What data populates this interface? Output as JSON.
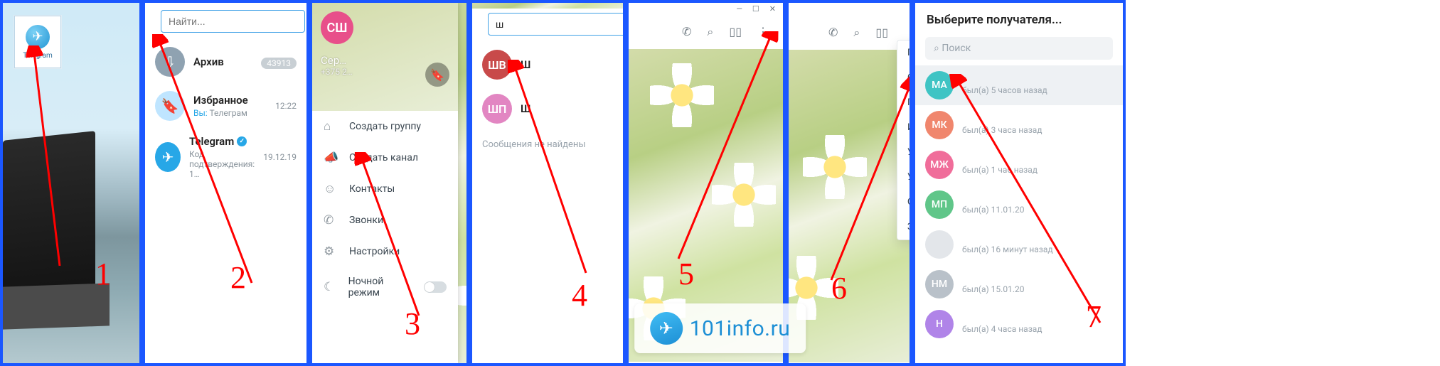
{
  "panel1": {
    "icon_label": "Telegram",
    "step": "1"
  },
  "panel2": {
    "search_placeholder": "Найти...",
    "archive": {
      "label": "Архив",
      "badge": "43913"
    },
    "saved": {
      "title": "Избранное",
      "sub_prefix": "Вы:",
      "sub_text": "Телеграм",
      "time": "12:22"
    },
    "telegram": {
      "title": "Telegram",
      "sub": "Код подтверждения: 1…",
      "time": "19.12.19"
    },
    "step": "2"
  },
  "panel3": {
    "avatar_initials": "СШ",
    "username": "Сер…",
    "phone": "+375 2…",
    "items": [
      "Создать группу",
      "Создать канал",
      "Контакты",
      "Звонки",
      "Настройки",
      "Ночной режим"
    ],
    "step": "3"
  },
  "panel4": {
    "query": "ш",
    "results": [
      {
        "initials": "ШВ",
        "label": "Ш"
      },
      {
        "initials": "ШП",
        "label": "Ш"
      }
    ],
    "not_found": "Сообщения не найдены",
    "step": "4"
  },
  "panel5": {
    "icons": [
      "phone-icon",
      "search-icon",
      "sidebar-icon",
      "more-icon"
    ],
    "step": "5"
  },
  "panel6": {
    "icons": [
      "phone-icon",
      "search-icon",
      "sidebar-icon"
    ],
    "menu": [
      "Показать профиль",
      "Отключить уведомления",
      "Поделиться контактом",
      "Изменить контакт",
      "Удалить контакт",
      "Удалить чат",
      "Очистить историю",
      "Заблокировать"
    ],
    "step": "6"
  },
  "panel7": {
    "title": "Выберите получателя...",
    "search_placeholder": "Поиск",
    "contacts": [
      {
        "initials": "МА",
        "color": "#3fc4c4",
        "sub": "был(а) 5 часов назад"
      },
      {
        "initials": "МК",
        "color": "#f0866d",
        "sub": "был(а) 3 часа назад"
      },
      {
        "initials": "МЖ",
        "color": "#f06d9a",
        "sub": "был(а) 1 час назад"
      },
      {
        "initials": "МП",
        "color": "#60c689",
        "sub": "был(а) 11.01.20"
      },
      {
        "initials": "",
        "color": "#e3e6ea",
        "sub": "был(а) 16 минут назад"
      },
      {
        "initials": "НМ",
        "color": "#b9c1c9",
        "sub": "был(а) 15.01.20"
      },
      {
        "initials": "Н",
        "color": "#b084e8",
        "sub": "был(а) 4 часа назад"
      }
    ],
    "step": "7"
  },
  "watermark": "101info.ru"
}
